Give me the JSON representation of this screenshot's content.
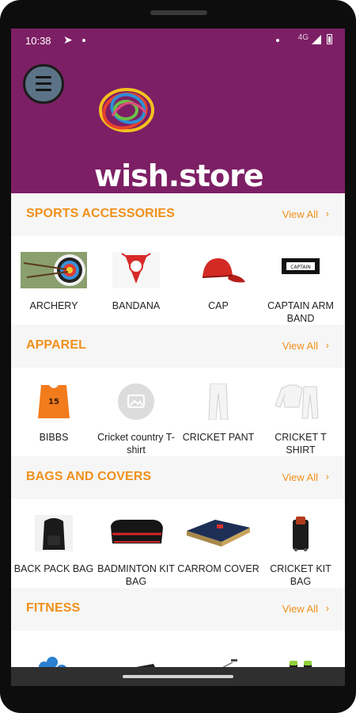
{
  "status_bar": {
    "time": "10:38",
    "network": "4G",
    "icons": [
      "telegram-icon",
      "notification-dot-icon",
      "signal-icon",
      "battery-icon"
    ]
  },
  "banner": {
    "logo_text": "wish.store",
    "menu_icon": "hamburger-menu-icon",
    "carousel_active_index": 0
  },
  "sections": [
    {
      "title": "SPORTS ACCESSORIES",
      "view_all": "View All",
      "items": [
        {
          "label": "ARCHERY",
          "icon": "archery-target-icon"
        },
        {
          "label": "BANDANA",
          "icon": "bandana-icon"
        },
        {
          "label": "CAP",
          "icon": "cap-icon"
        },
        {
          "label": "CAPTAIN ARM BAND",
          "icon": "captain-arm-band-icon",
          "band_text": "CAPTAIN"
        }
      ]
    },
    {
      "title": "APPAREL",
      "view_all": "View All",
      "items": [
        {
          "label": "BIBBS",
          "icon": "bibb-icon",
          "bib_number": "15"
        },
        {
          "label": "Cricket country T-shirt",
          "icon": "image-placeholder-icon"
        },
        {
          "label": "CRICKET PANT",
          "icon": "cricket-pant-icon"
        },
        {
          "label": "CRICKET T SHIRT",
          "icon": "cricket-tshirt-icon"
        }
      ]
    },
    {
      "title": "BAGS AND COVERS",
      "view_all": "View All",
      "items": [
        {
          "label": "BACK PACK BAG",
          "icon": "backpack-icon"
        },
        {
          "label": "BADMINTON KIT BAG",
          "icon": "badminton-kit-bag-icon"
        },
        {
          "label": "CARROM COVER",
          "icon": "carrom-cover-icon"
        },
        {
          "label": "CRICKET KIT BAG",
          "icon": "cricket-kit-bag-icon"
        }
      ]
    },
    {
      "title": "FITNESS",
      "view_all": "View All",
      "items": [
        {
          "label": "",
          "icon": "dumbbell-icon"
        },
        {
          "label": "",
          "icon": "bench-icon"
        },
        {
          "label": "",
          "icon": "skipping-rope-icon"
        },
        {
          "label": "",
          "icon": "resistance-tube-icon"
        }
      ]
    }
  ],
  "colors": {
    "brand": "#7d1f65",
    "accent": "#f0901b",
    "section_bg": "#f6f6f6"
  }
}
